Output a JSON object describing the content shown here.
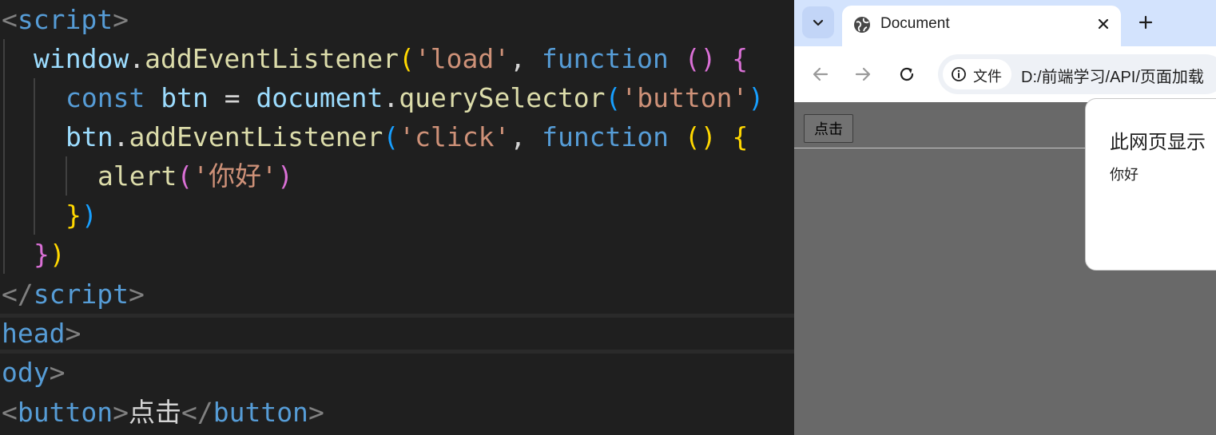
{
  "editor": {
    "lines": {
      "l1": {
        "open": "<",
        "tag": "script",
        "close": ">"
      },
      "l2": {
        "obj": "window",
        "dot": ".",
        "method": "addEventListener",
        "p1": "(",
        "str": "'load'",
        "comma": ", ",
        "kw": "function",
        "sp": " ",
        "parens": "()",
        "brace": "{"
      },
      "l3": {
        "kw": "const",
        "var": "btn",
        "eq": " = ",
        "obj": "document",
        "dot": ".",
        "method": "querySelector",
        "p1": "(",
        "str": "'button'",
        "p2": ")"
      },
      "l4": {
        "obj": "btn",
        "dot": ".",
        "method": "addEventListener",
        "p1": "(",
        "str": "'click'",
        "comma": ", ",
        "kw": "function",
        "parens": "()",
        "brace": "{"
      },
      "l5": {
        "method": "alert",
        "p1": "(",
        "str": "'你好'",
        "p2": ")"
      },
      "l6": {
        "brace": "}",
        "paren": ")"
      },
      "l7": {
        "brace": "}",
        "paren": ")"
      },
      "l8": {
        "open": "</",
        "tag": "script",
        "close": ">"
      },
      "l9": {
        "tag": "head",
        "close": ">"
      },
      "l10": {
        "tag": "ody",
        "close": ">"
      },
      "l11": {
        "open": "<",
        "tag": "button",
        "close": ">",
        "text": "点击",
        "open2": "</",
        "tag2": "button",
        "close2": ">"
      }
    }
  },
  "browser": {
    "tab": {
      "title": "Document"
    },
    "toolbar": {
      "security_chip": "文件",
      "url": "D:/前端学习/API/页面加载"
    },
    "page": {
      "button_label": "点击"
    },
    "dialog": {
      "title": "此网页显示",
      "message": "你好"
    }
  }
}
